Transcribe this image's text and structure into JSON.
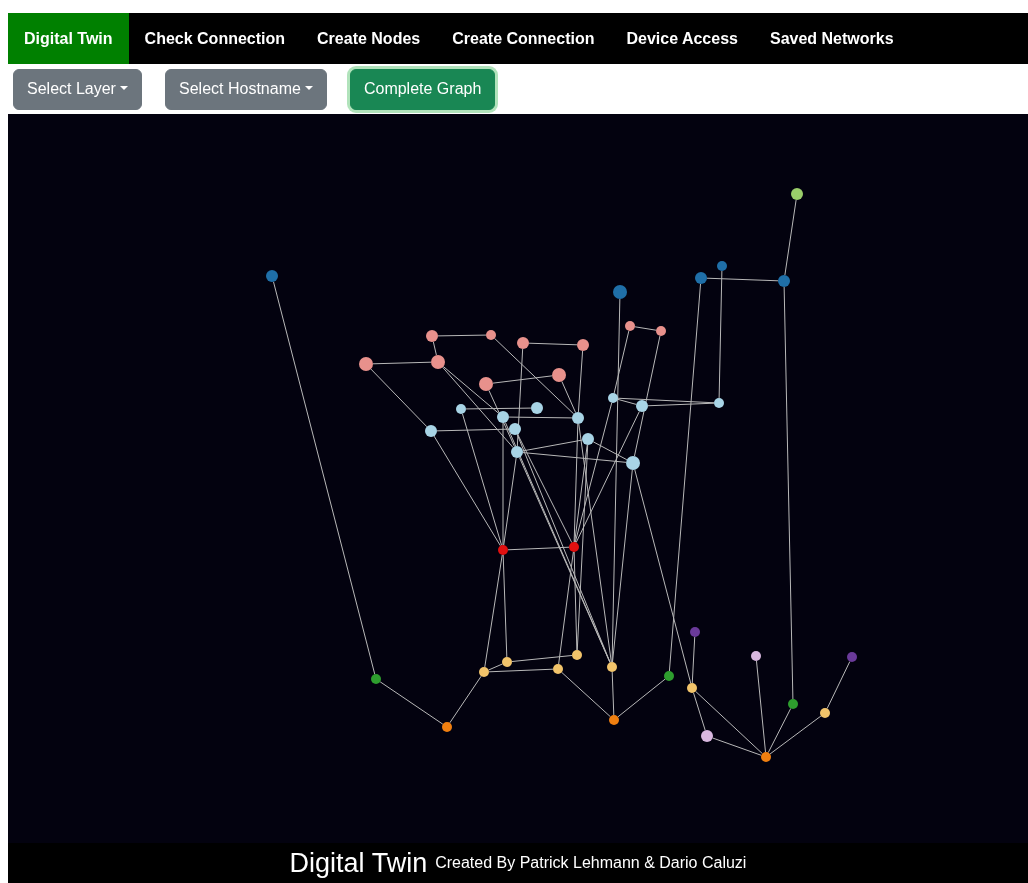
{
  "nav": [
    {
      "label": "Digital Twin",
      "selected": true
    },
    {
      "label": "Check Connection",
      "selected": false
    },
    {
      "label": "Create Nodes",
      "selected": false
    },
    {
      "label": "Create Connection",
      "selected": false
    },
    {
      "label": "Device Access",
      "selected": false
    },
    {
      "label": "Saved Networks",
      "selected": false
    }
  ],
  "toolbar": [
    {
      "kind": "dropdown",
      "label": "Select Layer"
    },
    {
      "kind": "dropdown",
      "label": "Select Hostname"
    },
    {
      "kind": "action",
      "label": "Complete Graph"
    }
  ],
  "graph": {
    "nodes": [
      {
        "color": "#1f6fa8"
      },
      {
        "color": "#9acd6a"
      },
      {
        "color": "#1f6fa8"
      },
      {
        "color": "#1f6fa8"
      },
      {
        "color": "#1f6fa8"
      },
      {
        "color": "#1f6fa8"
      },
      {
        "color": "#e8918c"
      },
      {
        "color": "#e8918c"
      },
      {
        "color": "#e8918c"
      },
      {
        "color": "#e8918c"
      },
      {
        "color": "#e8918c"
      },
      {
        "color": "#e8918c"
      },
      {
        "color": "#e8918c"
      },
      {
        "color": "#e8918c"
      },
      {
        "color": "#e8918c"
      },
      {
        "color": "#e8918c"
      },
      {
        "color": "#a8d4e6"
      },
      {
        "color": "#a8d4e6"
      },
      {
        "color": "#a8d4e6"
      },
      {
        "color": "#a8d4e6"
      },
      {
        "color": "#a8d4e6"
      },
      {
        "color": "#a8d4e6"
      },
      {
        "color": "#a8d4e6"
      },
      {
        "color": "#a8d4e6"
      },
      {
        "color": "#a8d4e6"
      },
      {
        "color": "#a8d4e6"
      },
      {
        "color": "#a8d4e6"
      },
      {
        "color": "#a8d4e6"
      },
      {
        "color": "#e01010"
      },
      {
        "color": "#e01010"
      },
      {
        "color": "#6a3a9a"
      },
      {
        "color": "#6a3a9a"
      },
      {
        "color": "#d9b8e0"
      },
      {
        "color": "#d9b8e0"
      },
      {
        "color": "#2e9e2e"
      },
      {
        "color": "#2e9e2e"
      },
      {
        "color": "#2e9e2e"
      },
      {
        "color": "#f2c46b"
      },
      {
        "color": "#f2c46b"
      },
      {
        "color": "#f2c46b"
      },
      {
        "color": "#f2c46b"
      },
      {
        "color": "#f2c46b"
      },
      {
        "color": "#f2c46b"
      },
      {
        "color": "#f2c46b"
      },
      {
        "color": "#f07f10"
      },
      {
        "color": "#f07f10"
      },
      {
        "color": "#f07f10"
      }
    ]
  },
  "footer": {
    "title": "Digital Twin",
    "credit": "Created By Patrick Lehmann & Dario Caluzi"
  }
}
